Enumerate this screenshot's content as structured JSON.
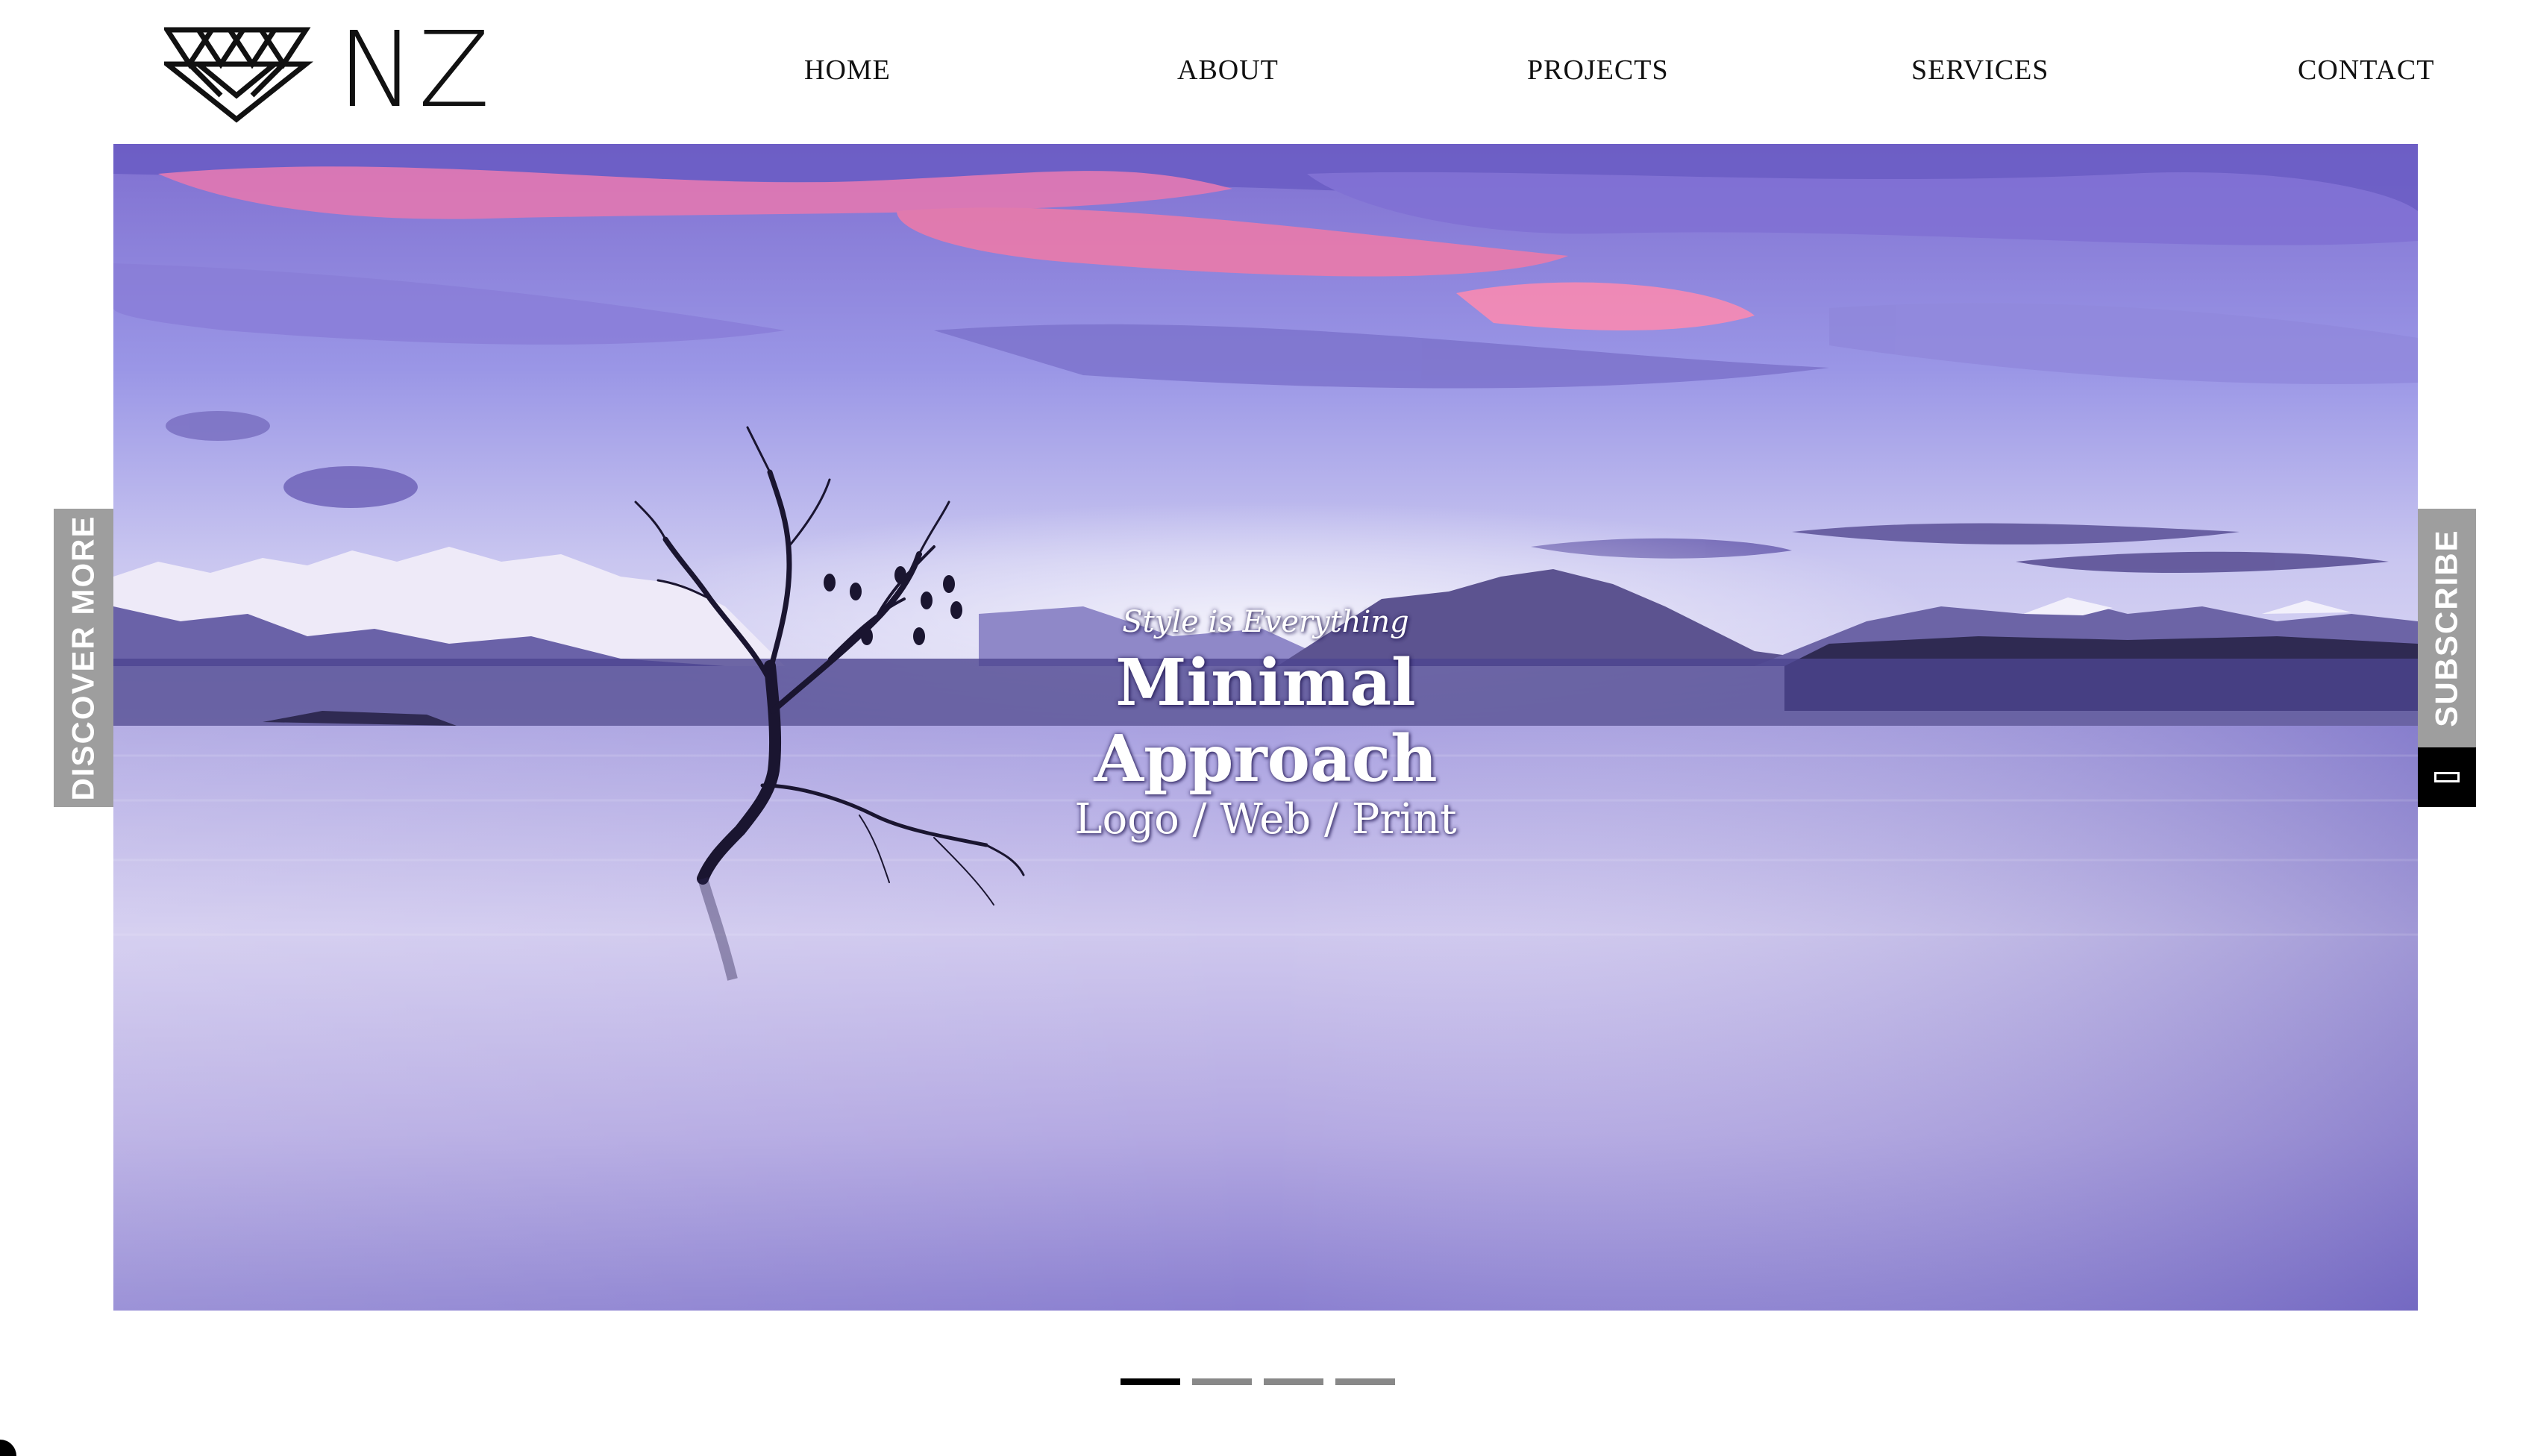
{
  "brand": {
    "name": "NZ"
  },
  "nav": {
    "items": [
      {
        "label": "HOME"
      },
      {
        "label": "ABOUT"
      },
      {
        "label": "PROJECTS"
      },
      {
        "label": "SERVICES"
      },
      {
        "label": "CONTACT"
      }
    ]
  },
  "hero": {
    "tagline": "Style is Everything",
    "headline_line1": "Minimal",
    "headline_line2": "Approach",
    "subline": "Logo / Web / Print",
    "image": "lake-tree-sunset-photo"
  },
  "side_tabs": {
    "left_label": "DISCOVER MORE",
    "right_label": "SUBSCRIBE"
  },
  "slider": {
    "total": 4,
    "active": 1
  },
  "colors": {
    "text": "#111111",
    "tab_bg": "#9e9e9e",
    "dot_active": "#000000",
    "dot_inactive": "#888888",
    "sky_pink": "#f07ab0",
    "lake_violet": "#8e86d4"
  }
}
